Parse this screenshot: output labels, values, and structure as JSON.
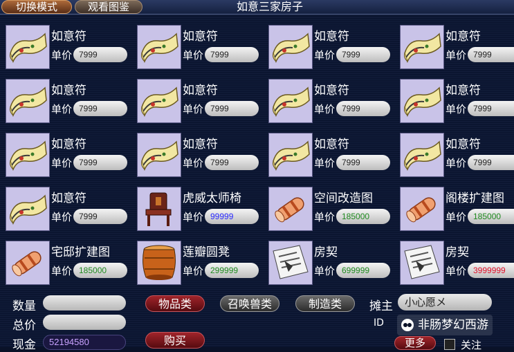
{
  "topbar": {
    "switch_mode_label": "切换模式",
    "view_catalog_label": "观看图鉴",
    "title": "如意三家房子"
  },
  "price_label": "单价",
  "items": [
    {
      "name": "如意符",
      "price": "7999",
      "price_color": "#222222",
      "icon": "scroll-talisman-icon"
    },
    {
      "name": "如意符",
      "price": "7999",
      "price_color": "#222222",
      "icon": "scroll-talisman-icon"
    },
    {
      "name": "如意符",
      "price": "7999",
      "price_color": "#222222",
      "icon": "scroll-talisman-icon"
    },
    {
      "name": "如意符",
      "price": "7999",
      "price_color": "#222222",
      "icon": "scroll-talisman-icon"
    },
    {
      "name": "如意符",
      "price": "7999",
      "price_color": "#222222",
      "icon": "scroll-talisman-icon"
    },
    {
      "name": "如意符",
      "price": "7999",
      "price_color": "#222222",
      "icon": "scroll-talisman-icon"
    },
    {
      "name": "如意符",
      "price": "7999",
      "price_color": "#222222",
      "icon": "scroll-talisman-icon"
    },
    {
      "name": "如意符",
      "price": "7999",
      "price_color": "#222222",
      "icon": "scroll-talisman-icon"
    },
    {
      "name": "如意符",
      "price": "7999",
      "price_color": "#222222",
      "icon": "scroll-talisman-icon"
    },
    {
      "name": "如意符",
      "price": "7999",
      "price_color": "#222222",
      "icon": "scroll-talisman-icon"
    },
    {
      "name": "如意符",
      "price": "7999",
      "price_color": "#222222",
      "icon": "scroll-talisman-icon"
    },
    {
      "name": "如意符",
      "price": "7999",
      "price_color": "#222222",
      "icon": "scroll-talisman-icon"
    },
    {
      "name": "如意符",
      "price": "7999",
      "price_color": "#222222",
      "icon": "scroll-talisman-icon"
    },
    {
      "name": "虎威太师椅",
      "price": "99999",
      "price_color": "#2a2aff",
      "icon": "chair-icon"
    },
    {
      "name": "空间改造图",
      "price": "185000",
      "price_color": "#1f8a1f",
      "icon": "blueprint-scroll-icon"
    },
    {
      "name": "阁楼扩建图",
      "price": "185000",
      "price_color": "#1f8a1f",
      "icon": "blueprint-scroll-icon"
    },
    {
      "name": "宅邸扩建图",
      "price": "185000",
      "price_color": "#1f8a1f",
      "icon": "blueprint-scroll-icon"
    },
    {
      "name": "莲瓣圆凳",
      "price": "299999",
      "price_color": "#1f8a1f",
      "icon": "stool-icon"
    },
    {
      "name": "房契",
      "price": "699999",
      "price_color": "#1f8a1f",
      "icon": "deed-paper-icon"
    },
    {
      "name": "房契",
      "price": "3999999",
      "price_color": "#e0102a",
      "icon": "deed-paper-icon"
    }
  ],
  "bottom": {
    "quantity_label": "数量",
    "total_label": "总价",
    "cash_label": "现金",
    "cash_value": "52194580",
    "cat_items": "物品类",
    "cat_pets": "召唤兽类",
    "cat_craft": "制造类",
    "buy_label": "购买",
    "owner_label": "摊主",
    "owner_name": "小心愿メ",
    "id_label": "ID",
    "more_label": "更多",
    "follow_label": "关注",
    "watermark": "非肠梦幻西游"
  }
}
